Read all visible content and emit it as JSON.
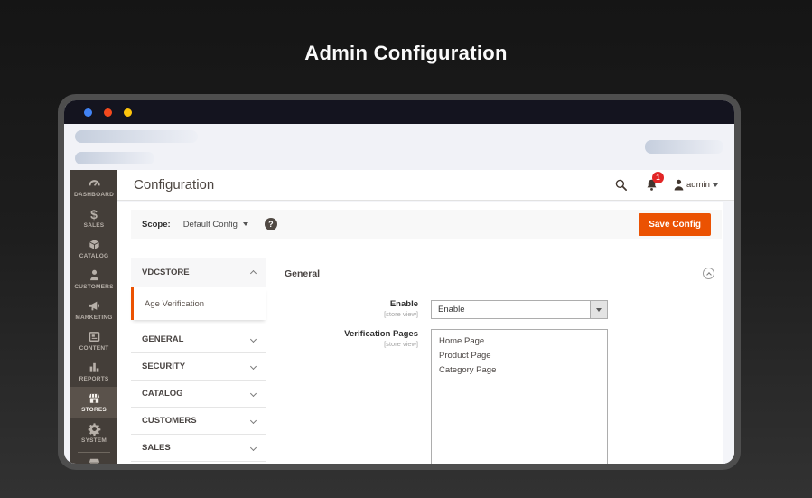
{
  "page": {
    "title": "Admin Configuration"
  },
  "browser": {
    "traffic_lights": {
      "blue": "#4183f4",
      "red": "#f4491d",
      "yellow": "#fec50c"
    }
  },
  "admin": {
    "colors": {
      "accent_orange": "#eb5202",
      "badge_red": "#e22626"
    },
    "header": {
      "title": "Configuration",
      "notification_count": "1",
      "user_label": "admin"
    },
    "sidebar": {
      "items": [
        {
          "label": "DASHBOARD"
        },
        {
          "label": "SALES"
        },
        {
          "label": "CATALOG"
        },
        {
          "label": "CUSTOMERS"
        },
        {
          "label": "MARKETING"
        },
        {
          "label": "CONTENT"
        },
        {
          "label": "REPORTS"
        },
        {
          "label": "STORES",
          "active": true
        },
        {
          "label": "SYSTEM"
        }
      ]
    },
    "scope_bar": {
      "scope_label": "Scope:",
      "scope_value": "Default Config",
      "help_glyph": "?",
      "save_button": "Save Config"
    },
    "config_nav": {
      "section_title": "VDCSTORE",
      "active_item": "Age Verification",
      "groups": [
        {
          "label": "GENERAL"
        },
        {
          "label": "SECURITY"
        },
        {
          "label": "CATALOG"
        },
        {
          "label": "CUSTOMERS"
        },
        {
          "label": "SALES"
        }
      ]
    },
    "content": {
      "section_title": "General",
      "fields": [
        {
          "label": "Enable",
          "scope": "[store view]",
          "value": "Enable"
        },
        {
          "label": "Verification Pages",
          "scope": "[store view]",
          "options": [
            {
              "label": "Home Page"
            },
            {
              "label": "Product Page"
            },
            {
              "label": "Category Page"
            }
          ]
        }
      ]
    }
  }
}
